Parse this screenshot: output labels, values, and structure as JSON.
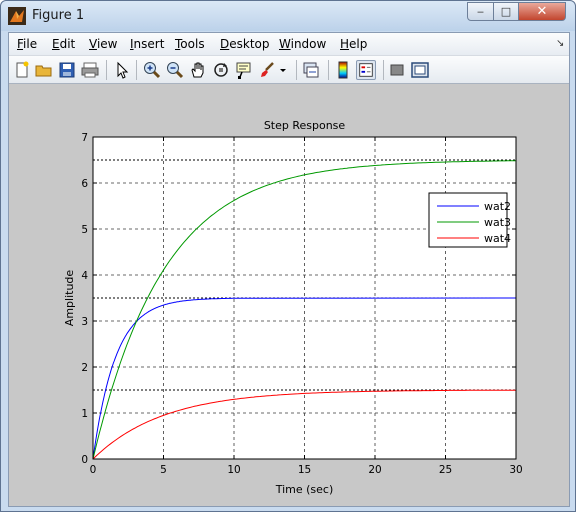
{
  "window": {
    "title": "Figure 1",
    "minimize_glyph": "‒",
    "maximize_glyph": "□",
    "close_glyph": "✕"
  },
  "menu": [
    {
      "key": "file",
      "mnemonic": "F",
      "rest": "ile"
    },
    {
      "key": "edit",
      "mnemonic": "E",
      "rest": "dit"
    },
    {
      "key": "view",
      "mnemonic": "V",
      "rest": "iew"
    },
    {
      "key": "insert",
      "mnemonic": "I",
      "rest": "nsert"
    },
    {
      "key": "tools",
      "mnemonic": "T",
      "rest": "ools"
    },
    {
      "key": "desktop",
      "mnemonic": "D",
      "rest": "esktop"
    },
    {
      "key": "window",
      "mnemonic": "W",
      "rest": "indow"
    },
    {
      "key": "help",
      "mnemonic": "H",
      "rest": "elp"
    }
  ],
  "toolbar": {
    "icons": [
      "new-figure-icon",
      "open-file-icon",
      "save-icon",
      "print-icon",
      "edit-plot-arrow-icon",
      "zoom-in-icon",
      "zoom-out-icon",
      "pan-hand-icon",
      "rotate-3d-icon",
      "data-cursor-icon",
      "brush-icon",
      "brush-dropdown-icon",
      "link-plot-icon",
      "insert-colorbar-icon",
      "insert-legend-icon",
      "hide-plot-tools-icon",
      "show-plot-tools-icon"
    ]
  },
  "colors": {
    "wat2": "#0000ff",
    "wat3": "#009900",
    "wat4": "#ff0000",
    "plot_bg": "#ffffff",
    "figure_bg": "#c8c8c8"
  },
  "chart_data": {
    "type": "line",
    "title": "Step Response",
    "xlabel": "Time (sec)",
    "ylabel": "Amplitude",
    "xlim": [
      0,
      30
    ],
    "ylim": [
      0,
      7
    ],
    "xticks": [
      0,
      5,
      10,
      15,
      20,
      25,
      30
    ],
    "yticks": [
      0,
      1,
      2,
      3,
      4,
      5,
      6,
      7
    ],
    "grid": true,
    "legend_position": "top-right",
    "series": [
      {
        "name": "wat2",
        "color": "#0000ff",
        "type": "first-order step",
        "gain": 3.5,
        "time_constant": 1.6,
        "settles_at": 10
      },
      {
        "name": "wat3",
        "color": "#009900",
        "type": "first-order step",
        "gain": 6.5,
        "time_constant": 5,
        "settles_at": 30
      },
      {
        "name": "wat4",
        "color": "#ff0000",
        "type": "first-order step",
        "gain": 1.5,
        "time_constant": 5,
        "settles_at": 30
      }
    ],
    "steady_state_lines": [
      6.5,
      3.5,
      1.5
    ]
  }
}
